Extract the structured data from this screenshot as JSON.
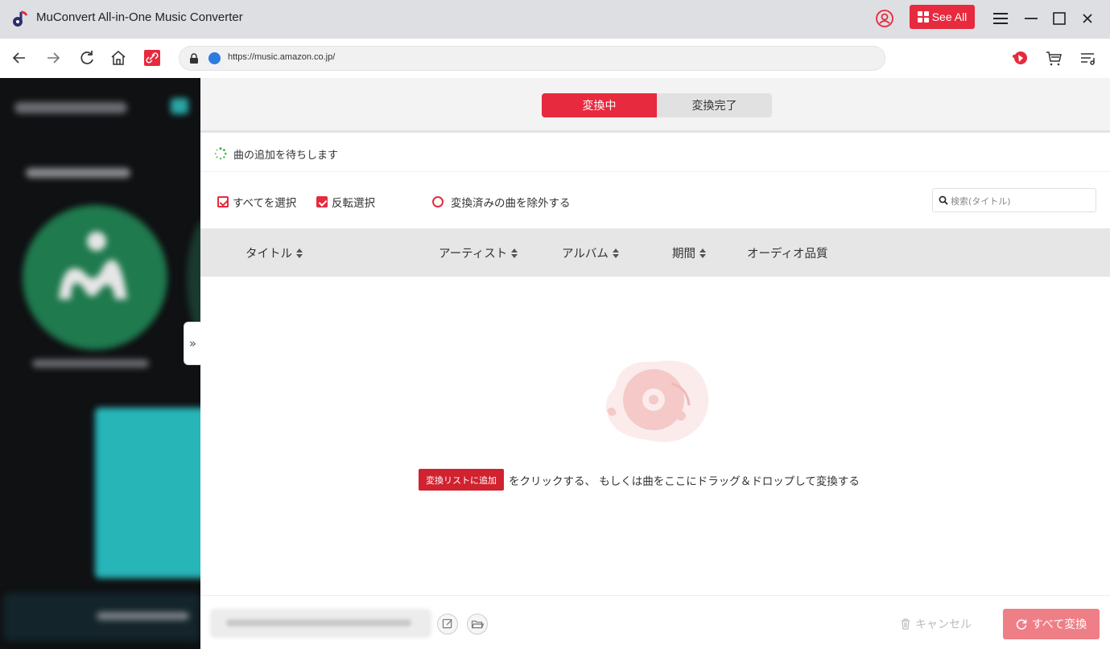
{
  "app": {
    "title": "MuConvert All-in-One Music Converter",
    "see_all_label": "See All",
    "accent_color": "#e72a3d"
  },
  "browser": {
    "url": "https://music.amazon.co.jp/"
  },
  "tabs": [
    {
      "label": "変換中",
      "active": true
    },
    {
      "label": "変換完了",
      "active": false
    }
  ],
  "status": {
    "text": "曲の追加を待ちします"
  },
  "toolbar": {
    "select_all_label": "すべてを選択",
    "invert_select_label": "反転選択",
    "exclude_converted_label": "変換済みの曲を除外する",
    "search_placeholder": "検索(タイトル)"
  },
  "table": {
    "columns": [
      "タイトル",
      "アーティスト",
      "アルバム",
      "期間",
      "オーディオ品質"
    ]
  },
  "empty_state": {
    "button_label": "変換リストに追加",
    "text": "をクリックする、 もしくは曲をここにドラッグ＆ドロップして変換する"
  },
  "footer": {
    "cancel_label": "キャンセル",
    "convert_all_label": "すべて変換"
  },
  "sidebar": {
    "expand_label": "»"
  }
}
